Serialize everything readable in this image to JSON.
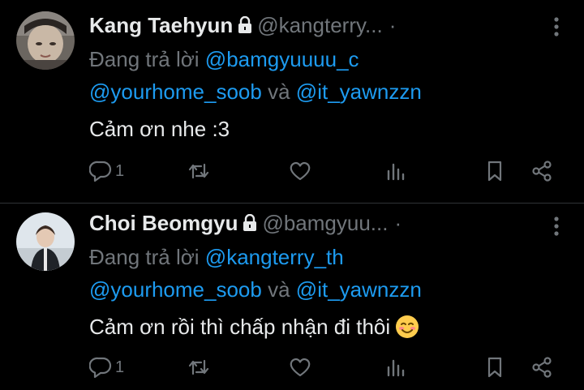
{
  "colors": {
    "background": "#000000",
    "text_primary": "#e7e9ea",
    "text_secondary": "#71767b",
    "mention": "#1d9bf0",
    "divider": "#2f3336"
  },
  "tweets": [
    {
      "display_name": "Kang Taehyun",
      "handle": "@kangterry...",
      "separator": "·",
      "reply_prefix": "Đang trả lời",
      "mention_1": "@bamgyuuuu_c",
      "mention_2": "@yourhome_soob",
      "joiner": "và",
      "mention_3": "@it_yawnzzn",
      "text": "Cảm ơn nhe :3",
      "reply_count": "1",
      "icons": [
        "lock-icon",
        "more-icon",
        "reply-icon",
        "retweet-icon",
        "like-icon",
        "views-icon",
        "bookmark-icon",
        "share-icon"
      ]
    },
    {
      "display_name": "Choi Beomgyu",
      "handle": "@bamgyuu...",
      "separator": "·",
      "reply_prefix": "Đang trả lời",
      "mention_1": "@kangterry_th",
      "mention_2": "@yourhome_soob",
      "joiner": "và",
      "mention_3": "@it_yawnzzn",
      "text": "Cảm ơn rồi thì chấp nhận đi thôi",
      "emoji": "smiling-face-icon",
      "reply_count": "1",
      "icons": [
        "lock-icon",
        "more-icon",
        "reply-icon",
        "retweet-icon",
        "like-icon",
        "views-icon",
        "bookmark-icon",
        "share-icon"
      ]
    }
  ]
}
